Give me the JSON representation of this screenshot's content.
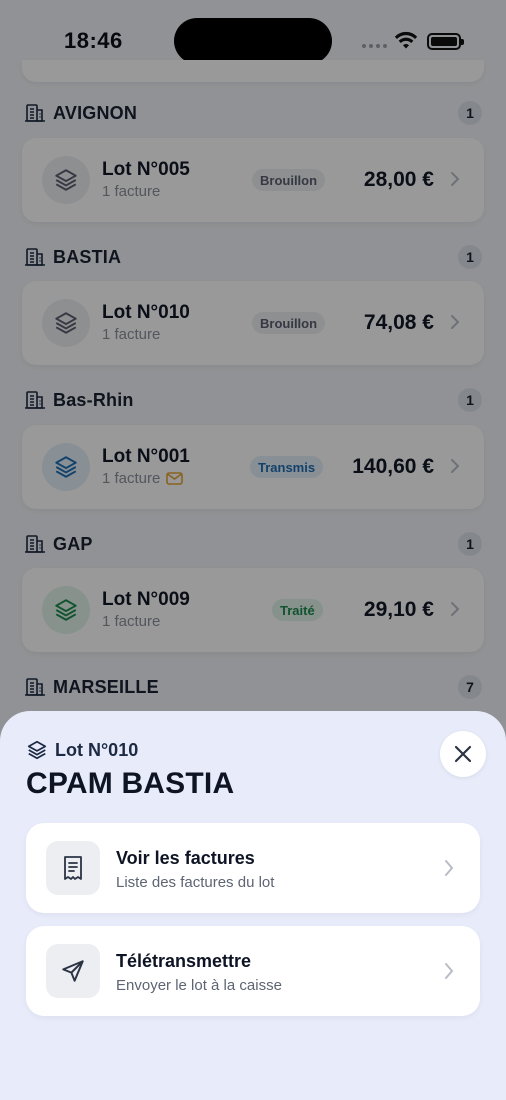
{
  "status_bar": {
    "time": "18:46"
  },
  "groups": [
    {
      "name": "AVIGNON",
      "count": "1",
      "lot": {
        "title": "Lot N°005",
        "subtitle": "1 facture",
        "badge": "Brouillon",
        "badge_color": "#5a6070",
        "badge_bg": "#eceef2",
        "amount": "28,00 €",
        "icon_color": "#5a6070",
        "icon_bg": "#eceef2",
        "mail_icon": false
      }
    },
    {
      "name": "BASTIA",
      "count": "1",
      "lot": {
        "title": "Lot N°010",
        "subtitle": "1 facture",
        "badge": "Brouillon",
        "badge_color": "#5a6070",
        "badge_bg": "#eceef2",
        "amount": "74,08 €",
        "icon_color": "#5a6070",
        "icon_bg": "#eceef2",
        "mail_icon": false
      }
    },
    {
      "name": "Bas-Rhin",
      "count": "1",
      "lot": {
        "title": "Lot N°001",
        "subtitle": "1 facture",
        "badge": "Transmis",
        "badge_color": "#1f6fb2",
        "badge_bg": "#e3eef9",
        "amount": "140,60 €",
        "icon_color": "#1f6fb2",
        "icon_bg": "#e3eef9",
        "mail_icon": true
      }
    },
    {
      "name": "GAP",
      "count": "1",
      "lot": {
        "title": "Lot N°009",
        "subtitle": "1 facture",
        "badge": "Traité",
        "badge_color": "#1e8a4f",
        "badge_bg": "#e2f4ea",
        "amount": "29,10 €",
        "icon_color": "#1e8a4f",
        "icon_bg": "#e2f4ea",
        "mail_icon": false
      }
    },
    {
      "name": "MARSEILLE",
      "count": "7"
    }
  ],
  "sheet": {
    "lot_label": "Lot N°010",
    "title": "CPAM BASTIA",
    "actions": [
      {
        "title": "Voir les factures",
        "subtitle": "Liste des factures du lot",
        "icon": "receipt-icon"
      },
      {
        "title": "Télétransmettre",
        "subtitle": "Envoyer le lot à la caisse",
        "icon": "send-icon"
      }
    ]
  },
  "colors": {
    "sheet_bg": "#e8ecfa",
    "text_dark": "#0e1424"
  }
}
